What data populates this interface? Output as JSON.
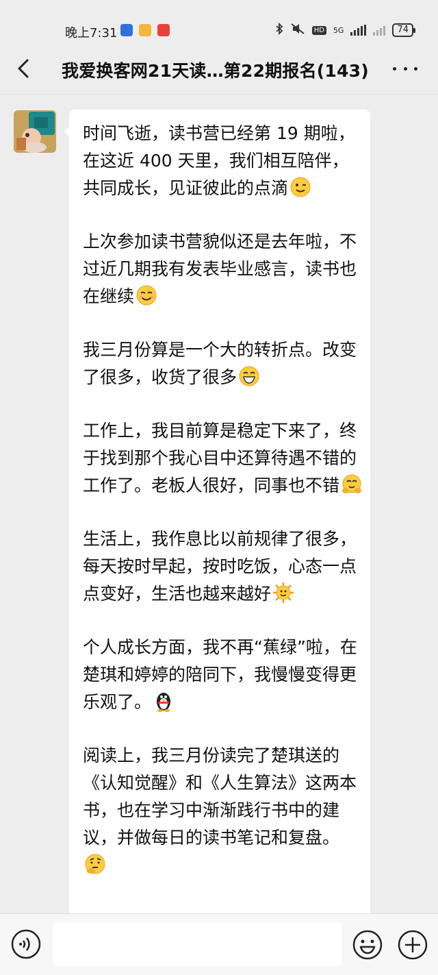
{
  "status_bar": {
    "time": "晚上7:31",
    "network": "5G",
    "battery": "74",
    "icons": [
      "bluetooth-icon",
      "mute-icon",
      "hd-icon",
      "signal-icon",
      "signal-icon-2",
      "battery-icon"
    ]
  },
  "chat": {
    "title": "我爱换客网21天读…第22期报名(143)"
  },
  "message": {
    "paragraphs": [
      {
        "text": "时间飞逝，读书营已经第 19 期啦，在这近 400 天里，我们相互陪伴，共同成长，见证彼此的点滴",
        "emoji": "wink-emoji"
      },
      {
        "text": "上次参加读书营貌似还是去年啦，不过近几期我有发表毕业感言，读书也在继续",
        "emoji": "smile-emoji"
      },
      {
        "text": "我三月份算是一个大的转折点。改变了很多，收货了很多",
        "emoji": "grin-emoji"
      },
      {
        "text": "工作上，我目前算是稳定下来了，终于找到那个我心目中还算待遇不错的工作了。老板人很好，同事也不错",
        "emoji": "hug-emoji"
      },
      {
        "text": "生活上，我作息比以前规律了很多，每天按时早起，按时吃饭，心态一点点变好，生活也越来越好",
        "emoji": "sun-emoji"
      },
      {
        "text": "个人成长方面，我不再“蕉绿”啦，在楚琪和婷婷的陪同下，我慢慢变得更乐观了。",
        "emoji": "penguin-emoji"
      },
      {
        "text": "阅读上，我三月份读完了楚琪送的《认知觉醒》和《人生算法》这两本书，也在学习中渐渐践行书中的建议，并做每日的读书笔记和复盘。",
        "emoji": "thinking-emoji"
      }
    ]
  },
  "input": {
    "placeholder": ""
  },
  "colors": {
    "background": "#ededed",
    "bubble": "#ffffff",
    "text": "#111111"
  }
}
